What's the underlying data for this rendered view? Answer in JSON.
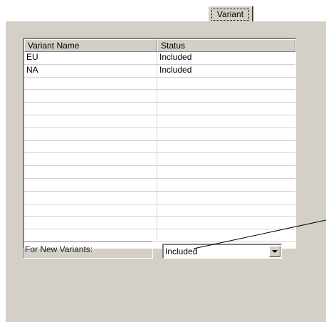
{
  "tab": {
    "label": "Variant"
  },
  "grid": {
    "columns": [
      "Variant Name",
      "Status"
    ],
    "rows": [
      [
        "EU",
        "Included"
      ],
      [
        "NA",
        "Included"
      ],
      [
        "",
        ""
      ],
      [
        "",
        ""
      ],
      [
        "",
        ""
      ],
      [
        "",
        ""
      ],
      [
        "",
        ""
      ],
      [
        "",
        ""
      ],
      [
        "",
        ""
      ],
      [
        "",
        ""
      ],
      [
        "",
        ""
      ],
      [
        "",
        ""
      ],
      [
        "",
        ""
      ],
      [
        "",
        ""
      ],
      [
        "",
        ""
      ]
    ]
  },
  "new_variants": {
    "label": "For New Variants:",
    "value": "Included"
  },
  "icons": {
    "dropdown": "chevron-down-icon"
  }
}
